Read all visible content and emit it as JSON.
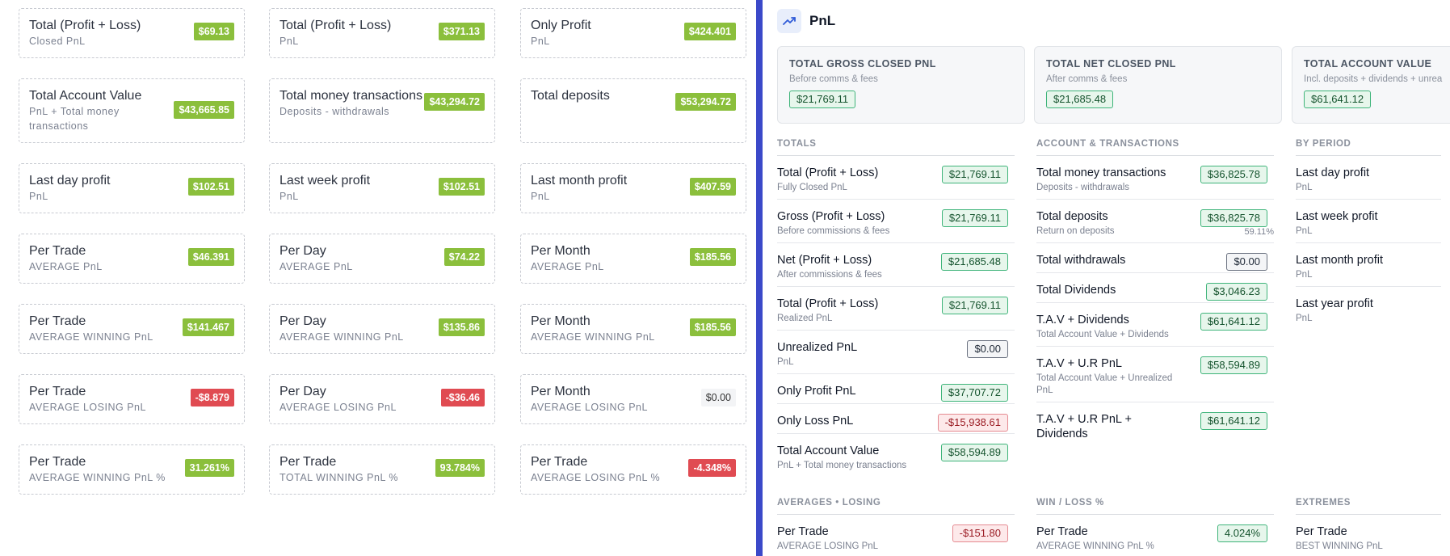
{
  "left": {
    "cards": [
      {
        "title": "Total (Profit + Loss)",
        "sub": "Closed PnL",
        "value": "$69.13",
        "tone": "green"
      },
      {
        "title": "Total (Profit + Loss)",
        "sub": "PnL",
        "value": "$371.13",
        "tone": "green"
      },
      {
        "title": "Only Profit",
        "sub": "PnL",
        "value": "$424.401",
        "tone": "green"
      },
      {
        "title": "Total Account Value",
        "sub": "PnL + Total money transactions",
        "value": "$43,665.85",
        "tone": "green"
      },
      {
        "title": "Total money transactions",
        "sub": "Deposits - withdrawals",
        "value": "$43,294.72",
        "tone": "green"
      },
      {
        "title": "Total deposits",
        "sub": "",
        "value": "$53,294.72",
        "tone": "green"
      },
      {
        "title": "Last day profit",
        "sub": "PnL",
        "value": "$102.51",
        "tone": "green"
      },
      {
        "title": "Last week profit",
        "sub": "PnL",
        "value": "$102.51",
        "tone": "green"
      },
      {
        "title": "Last month profit",
        "sub": "PnL",
        "value": "$407.59",
        "tone": "green"
      },
      {
        "title": "Per Trade",
        "sub": "AVERAGE PnL",
        "value": "$46.391",
        "tone": "green"
      },
      {
        "title": "Per Day",
        "sub": "AVERAGE PnL",
        "value": "$74.22",
        "tone": "green"
      },
      {
        "title": "Per Month",
        "sub": "AVERAGE PnL",
        "value": "$185.56",
        "tone": "green"
      },
      {
        "title": "Per Trade",
        "sub": "AVERAGE WINNING PnL",
        "value": "$141.467",
        "tone": "green"
      },
      {
        "title": "Per Day",
        "sub": "AVERAGE WINNING PnL",
        "value": "$135.86",
        "tone": "green"
      },
      {
        "title": "Per Month",
        "sub": "AVERAGE WINNING PnL",
        "value": "$185.56",
        "tone": "green"
      },
      {
        "title": "Per Trade",
        "sub": "AVERAGE LOSING PnL",
        "value": "-$8.879",
        "tone": "red"
      },
      {
        "title": "Per Day",
        "sub": "AVERAGE LOSING PnL",
        "value": "-$36.46",
        "tone": "red"
      },
      {
        "title": "Per Month",
        "sub": "AVERAGE LOSING PnL",
        "value": "$0.00",
        "tone": "none"
      },
      {
        "title": "Per Trade",
        "sub": "AVERAGE WINNING PnL %",
        "value": "31.261%",
        "tone": "green"
      },
      {
        "title": "Per Trade",
        "sub": "TOTAL WINNING PnL %",
        "value": "93.784%",
        "tone": "green"
      },
      {
        "title": "Per Trade",
        "sub": "AVERAGE LOSING PnL %",
        "value": "-4.348%",
        "tone": "red"
      }
    ]
  },
  "right": {
    "header": {
      "title": "PnL",
      "icon": "trending-up-icon"
    },
    "summary": [
      {
        "title": "TOTAL GROSS CLOSED PNL",
        "sub": "Before comms & fees",
        "value": "$21,769.11"
      },
      {
        "title": "TOTAL NET CLOSED PNL",
        "sub": "After comms & fees",
        "value": "$21,685.48"
      },
      {
        "title": "TOTAL ACCOUNT VALUE",
        "sub": "Incl. deposits + dividends + unrea",
        "value": "$61,641.12"
      }
    ],
    "totals": {
      "heading": "TOTALS",
      "rows": [
        {
          "title": "Total (Profit + Loss)",
          "sub": "Fully Closed PnL",
          "value": "$21,769.11",
          "tone": "green"
        },
        {
          "title": "Gross (Profit + Loss)",
          "sub": "Before commissions & fees",
          "value": "$21,769.11",
          "tone": "green"
        },
        {
          "title": "Net (Profit + Loss)",
          "sub": "After commissions & fees",
          "value": "$21,685.48",
          "tone": "green"
        },
        {
          "title": "Total (Profit + Loss)",
          "sub": "Realized PnL",
          "value": "$21,769.11",
          "tone": "green"
        },
        {
          "title": "Unrealized PnL",
          "sub": "PnL",
          "value": "$0.00",
          "tone": "gray"
        },
        {
          "title": "Only Profit PnL",
          "sub": "",
          "value": "$37,707.72",
          "tone": "green"
        },
        {
          "title": "Only Loss PnL",
          "sub": "",
          "value": "-$15,938.61",
          "tone": "red"
        },
        {
          "title": "Total Account Value",
          "sub": "PnL + Total money transactions",
          "value": "$58,594.89",
          "tone": "green"
        }
      ]
    },
    "account": {
      "heading": "ACCOUNT & TRANSACTIONS",
      "rows": [
        {
          "title": "Total money transactions",
          "sub": "Deposits - withdrawals",
          "value": "$36,825.78",
          "tone": "green",
          "extra": ""
        },
        {
          "title": "Total deposits",
          "sub": "Return on deposits",
          "value": "$36,825.78",
          "tone": "green",
          "extra": "59.11%"
        },
        {
          "title": "Total withdrawals",
          "sub": "",
          "value": "$0.00",
          "tone": "gray",
          "extra": ""
        },
        {
          "title": "Total Dividends",
          "sub": "",
          "value": "$3,046.23",
          "tone": "green",
          "extra": ""
        },
        {
          "title": "T.A.V + Dividends",
          "sub": "Total Account Value + Dividends",
          "value": "$61,641.12",
          "tone": "green",
          "extra": ""
        },
        {
          "title": "T.A.V + U.R PnL",
          "sub": "Total Account Value + Unrealized PnL",
          "value": "$58,594.89",
          "tone": "green",
          "extra": ""
        },
        {
          "title": "T.A.V + U.R PnL + Dividends",
          "sub": "",
          "value": "$61,641.12",
          "tone": "green",
          "extra": ""
        }
      ]
    },
    "period": {
      "heading": "BY PERIOD",
      "rows": [
        {
          "title": "Last day profit",
          "sub": "PnL"
        },
        {
          "title": "Last week profit",
          "sub": "PnL"
        },
        {
          "title": "Last month profit",
          "sub": "PnL"
        },
        {
          "title": "Last year profit",
          "sub": "PnL"
        }
      ]
    },
    "averages_losing": {
      "heading": "AVERAGES • LOSING",
      "rows": [
        {
          "title": "Per Trade",
          "sub": "AVERAGE LOSING PnL",
          "value": "-$151.80",
          "tone": "red"
        }
      ]
    },
    "winloss": {
      "heading": "WIN / LOSS %",
      "rows": [
        {
          "title": "Per Trade",
          "sub": "AVERAGE WINNING PnL %",
          "value": "4.024%",
          "tone": "green"
        }
      ]
    },
    "extremes": {
      "heading": "EXTREMES",
      "rows": [
        {
          "title": "Per Trade",
          "sub": "BEST WINNING PnL"
        }
      ]
    }
  }
}
